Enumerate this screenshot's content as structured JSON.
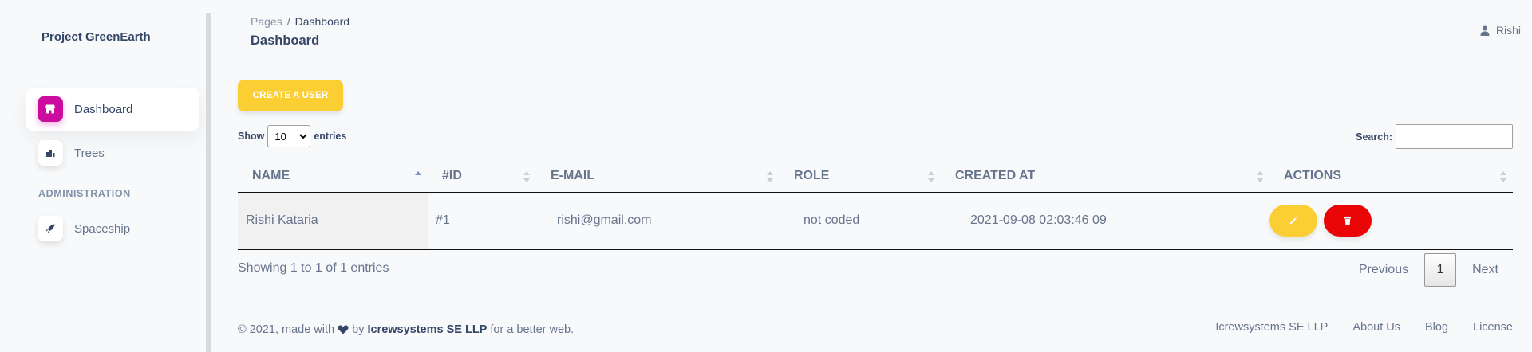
{
  "sidebar": {
    "brand": "Project GreenEarth",
    "items": [
      {
        "label": "Dashboard",
        "icon": "shop-icon",
        "active": true
      },
      {
        "label": "Trees",
        "icon": "chart-bar-icon",
        "active": false
      }
    ],
    "section_title": "ADMINISTRATION",
    "admin_items": [
      {
        "label": "Spaceship",
        "icon": "rocket-icon"
      }
    ]
  },
  "header": {
    "breadcrumb_root": "Pages",
    "breadcrumb_separator": "/",
    "breadcrumb_current": "Dashboard",
    "title": "Dashboard",
    "user_name": "Rishi"
  },
  "toolbar": {
    "create_label": "Create a user"
  },
  "table_controls": {
    "show_label": "Show",
    "entries_label": "entries",
    "page_length": "10",
    "search_label": "Search:",
    "search_value": ""
  },
  "table": {
    "columns": [
      "Name",
      "#ID",
      "E-mail",
      "Role",
      "Created at",
      "Actions"
    ],
    "sorted_column": "Name",
    "sort_direction": "ascending",
    "rows": [
      {
        "name": "Rishi Kataria",
        "id": "#1",
        "email": "rishi@gmail.com",
        "role": "not coded",
        "created_at": "2021-09-08 02:03:46 09"
      }
    ]
  },
  "info": {
    "text": "Showing 1 to 1 of 1 entries"
  },
  "pagination": {
    "previous": "Previous",
    "current_page": "1",
    "next": "Next"
  },
  "footer": {
    "copyright_prefix": "© 2021, made with",
    "by": "by",
    "company": "Icrewsystems SE LLP",
    "suffix": "for a better web.",
    "links": [
      "Icrewsystems SE LLP",
      "About Us",
      "Blog",
      "License"
    ]
  },
  "colors": {
    "primary_gradient": "#cb0c9f",
    "warning": "#fbcf33",
    "danger": "#ea0606",
    "text_dark": "#344767",
    "text_muted": "#67748e"
  }
}
